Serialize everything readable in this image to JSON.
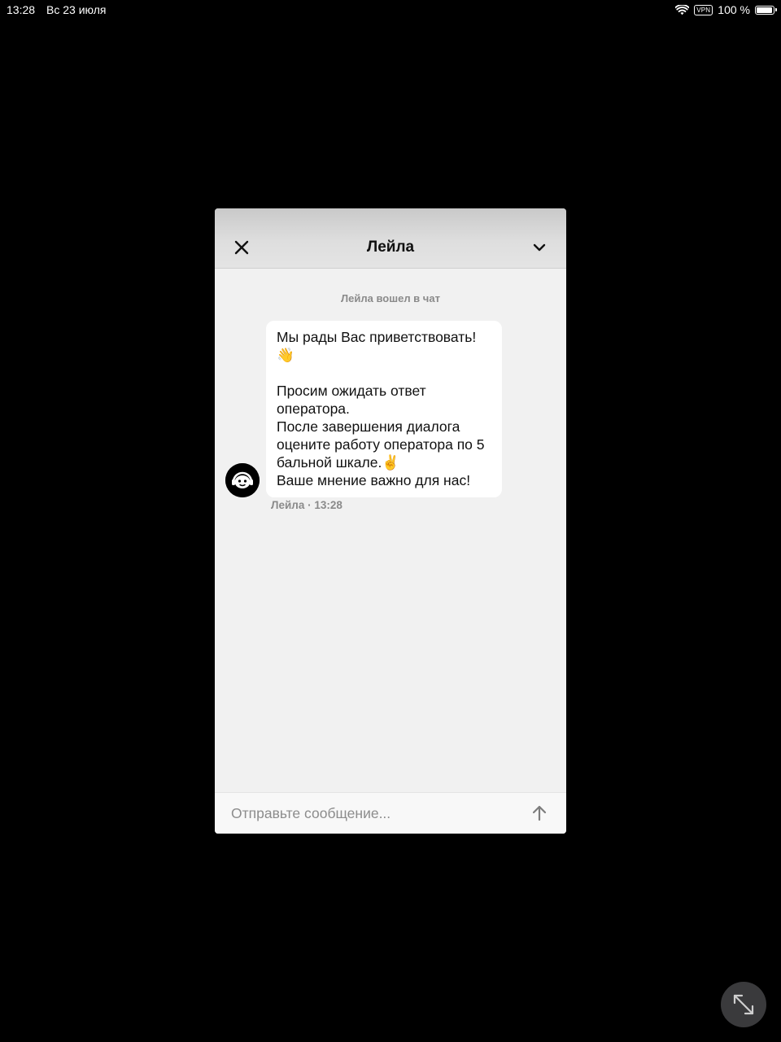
{
  "status_bar": {
    "time": "13:28",
    "date": "Вс 23 июля",
    "vpn_label": "VPN",
    "battery_text": "100 %",
    "battery_level": 1.0
  },
  "chat": {
    "header": {
      "title": "Лейла",
      "close_icon": "close-icon",
      "collapse_icon": "chevron-down-icon"
    },
    "system_message": "Лейла вошел в чат",
    "messages": [
      {
        "text": "Мы рады Вас приветствовать!\n👋\n\nПросим ожидать ответ оператора.\nПосле завершения диалога оцените работу оператора по 5 бальной шкале.✌️\nВаше мнение важно для нас!",
        "meta": "Лейла · 13:28",
        "avatar_icon": "operator-avatar-icon"
      }
    ],
    "composer": {
      "placeholder": "Отправьте сообщение...",
      "send_icon": "arrow-up-icon"
    }
  },
  "overlay": {
    "expand_icon": "expand-arrows-icon"
  },
  "colors": {
    "background": "#000000",
    "panel": "#f1f1f1",
    "bubble": "#ffffff",
    "muted_text": "#8a8a8a"
  }
}
